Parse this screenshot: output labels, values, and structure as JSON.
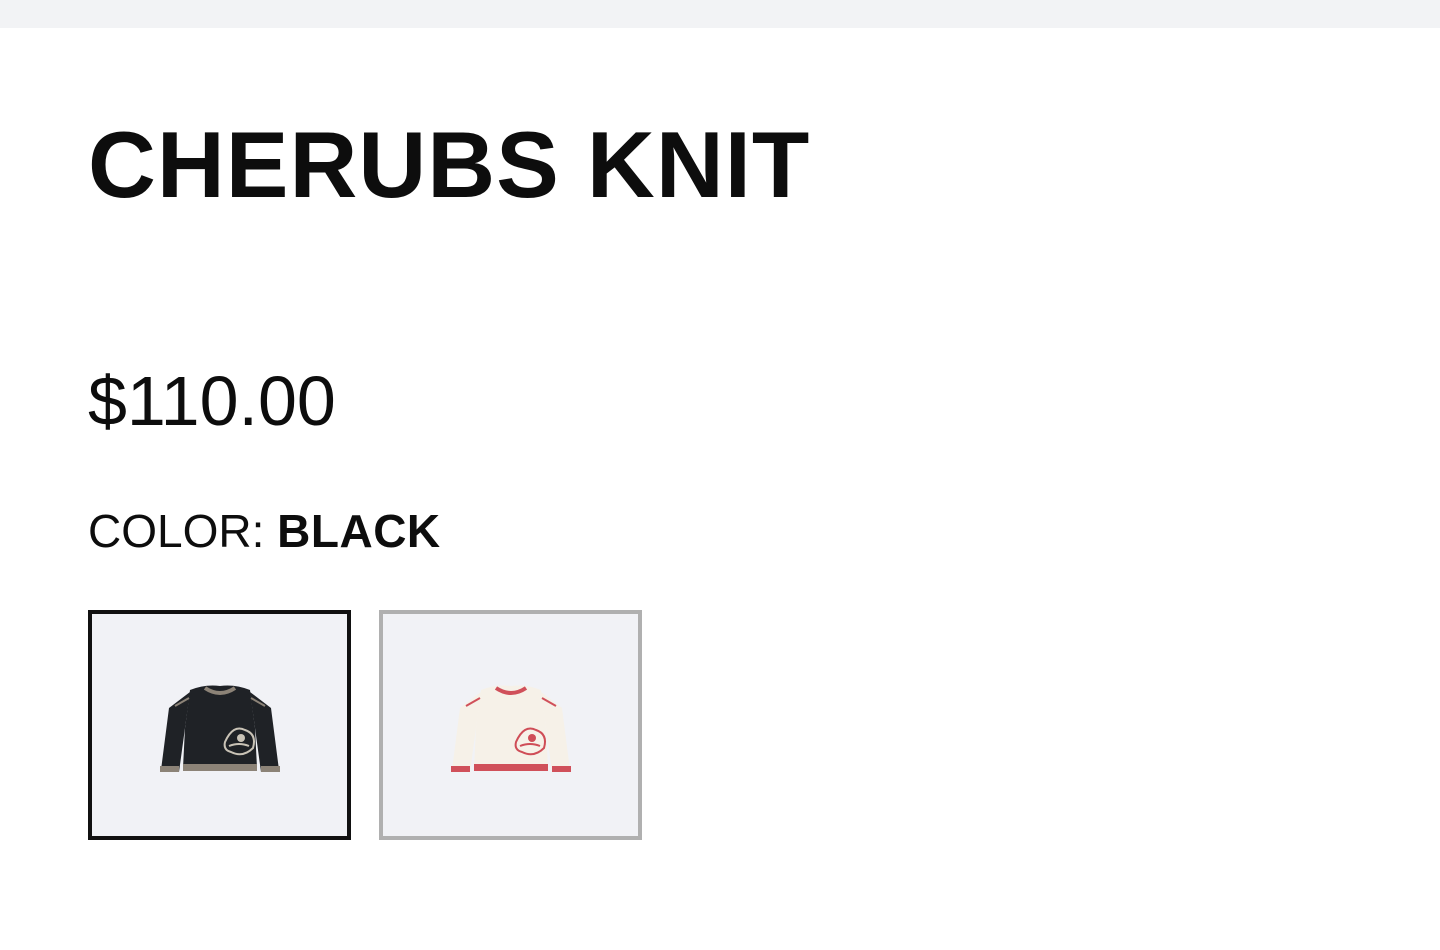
{
  "product": {
    "title": "CHERUBS KNIT",
    "price": "$110.00",
    "color_label": "COLOR:",
    "selected_color": "BLACK"
  },
  "swatches": [
    {
      "color": "BLACK",
      "selected": true,
      "body_color": "#1f2226",
      "trim_color": "#8c8377",
      "motif_color": "#c9c3b6"
    },
    {
      "color": "CREAM",
      "selected": false,
      "body_color": "#f6f1e8",
      "trim_color": "#d0505a",
      "motif_color": "#cf4d57"
    }
  ],
  "colors": {
    "text": "#0d0d0d",
    "selected_border": "#111111",
    "unselected_border": "#b0b0b0",
    "swatch_background": "#f1f2f6",
    "top_strip": "#f2f3f5"
  }
}
